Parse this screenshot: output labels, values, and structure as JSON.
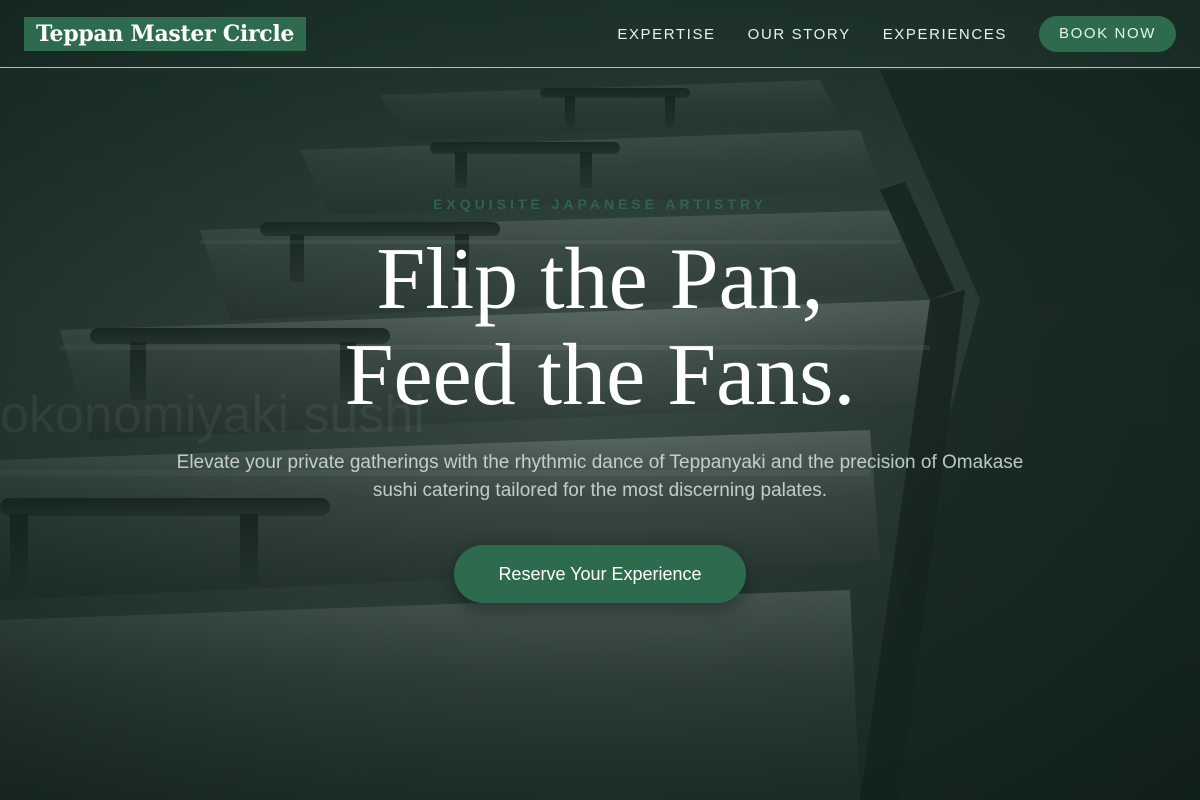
{
  "header": {
    "brand": "Teppan Master Circle",
    "nav": {
      "expertise": "EXPERTISE",
      "our_story": "OUR STORY",
      "experiences": "EXPERIENCES"
    },
    "book_now": "BOOK NOW"
  },
  "hero": {
    "eyebrow": "EXQUISITE JAPANESE ARTISTRY",
    "headline_line1": "Flip the Pan,",
    "headline_line2": "Feed the Fans.",
    "background_watermark": "okonomiyaki sushi",
    "subtitle": "Elevate your private gatherings with the rhythmic dance of Teppanyaki and the precision of Omakase sushi catering tailored for the most discerning palates.",
    "cta": "Reserve Your Experience"
  },
  "colors": {
    "accent": "#2e6a4d",
    "overlay": "#0f1a15",
    "text": "#ffffff"
  }
}
